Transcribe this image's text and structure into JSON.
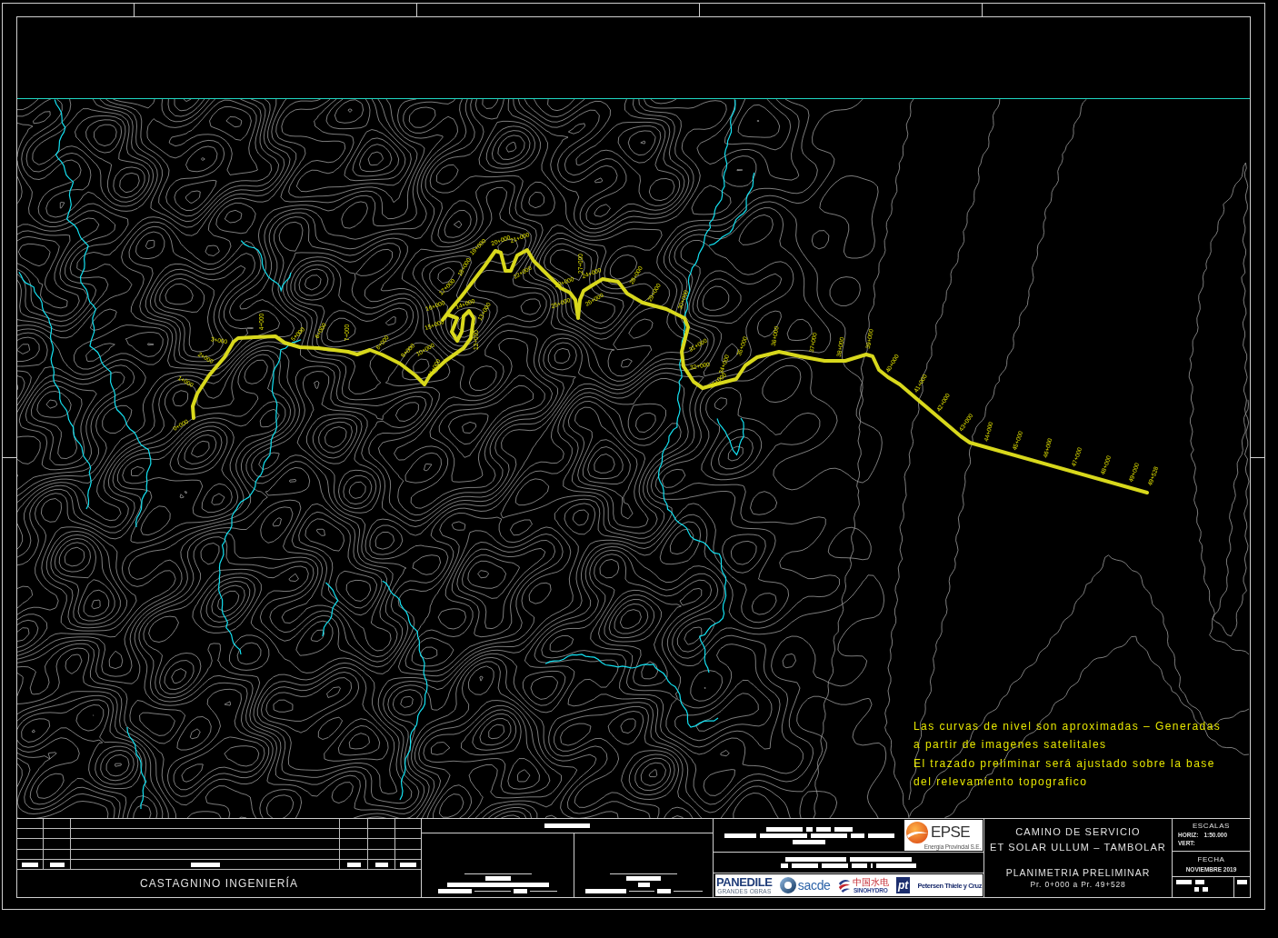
{
  "drawing": {
    "stations": [
      "0+000",
      "1+000",
      "2+000",
      "3+000",
      "4+000",
      "5+000",
      "6+000",
      "7+000",
      "8+000",
      "9+000",
      "10+000",
      "11+000",
      "12+000",
      "13+000",
      "14+000",
      "15+000",
      "16+000",
      "17+000",
      "18+000",
      "19+000",
      "20+000",
      "21+000",
      "22+000",
      "23+000",
      "24+000",
      "25+000",
      "26+000",
      "27+000",
      "28+000",
      "29+000",
      "30+000",
      "31+000",
      "32+000",
      "33+000",
      "34+000",
      "35+000",
      "36+000",
      "37+000",
      "38+000",
      "39+000",
      "40+000",
      "41+000",
      "42+000",
      "43+000",
      "44+000",
      "45+000",
      "46+000",
      "47+000",
      "48+000",
      "49+000",
      "49+528"
    ],
    "note": [
      "Las curvas de nivel son aproximadas – Generadas",
      "a partir de imagenes satelitales",
      "El trazado preliminar será ajustado sobre la base",
      "del relevamiento topografico"
    ]
  },
  "title_block": {
    "company": "CASTAGNINO INGENIERÍA",
    "client_logo": {
      "kind": "epse",
      "name": "EPSE",
      "tagline": "Energía Provincial S.E."
    },
    "partner_logos": [
      {
        "kind": "panedile",
        "name": "PANEDILE",
        "tagline": "GRANDES OBRAS"
      },
      {
        "kind": "sacde",
        "name": "sacde"
      },
      {
        "kind": "sinohydro",
        "name": "中国水电",
        "tagline": "SINOHYDRO"
      },
      {
        "kind": "monogram",
        "name": "pt"
      },
      {
        "kind": "wordmark",
        "name": "Petersen Thiele y Cruz"
      }
    ],
    "title": [
      "CAMINO DE SERVICIO",
      "ET SOLAR ULLUM – TAMBOLAR"
    ],
    "subtitle": "PLANIMETRIA PRELIMINAR",
    "range": "Pr. 0+000 a Pr. 49+528",
    "scales": {
      "heading": "ESCALAS",
      "rows": [
        {
          "label": "HORIZ:",
          "value": "1:50.000"
        },
        {
          "label": "VERT:"
        }
      ]
    },
    "date": {
      "heading": "FECHA",
      "value": "NOVIEMBRE 2019"
    }
  }
}
